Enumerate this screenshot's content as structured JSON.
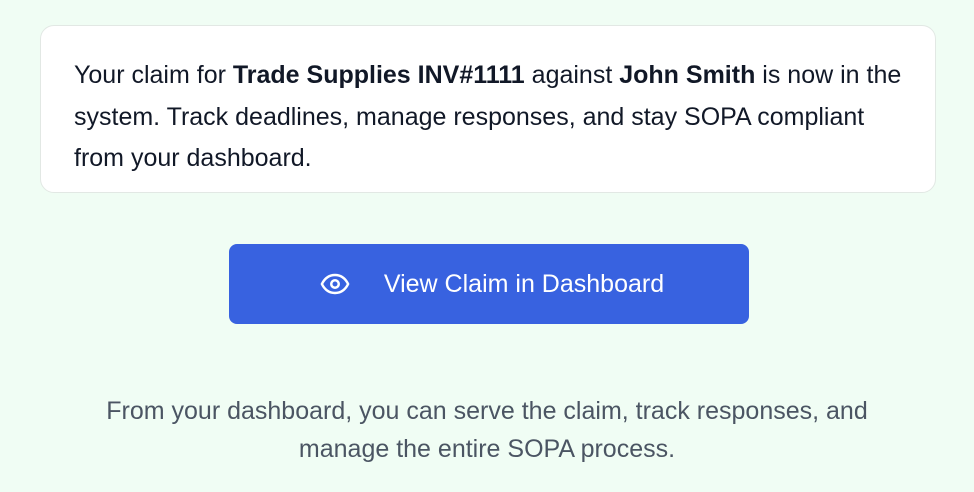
{
  "confirmation": {
    "part1": "Your claim for ",
    "claim_name": "Trade Supplies INV#1111",
    "part2": " against ",
    "respondent": "John Smith",
    "part3": " is now in the system. Track deadlines, manage responses, and stay SOPA compliant from your dashboard."
  },
  "cta": {
    "label": "View Claim in Dashboard",
    "icon": "eye-icon",
    "color": "#3862e0"
  },
  "footer": {
    "line1": "From your dashboard, you can serve the claim, track responses, and",
    "line2": "manage the entire SOPA process."
  },
  "colors": {
    "background": "#f0fdf4",
    "card": "#ffffff",
    "text": "#111827",
    "muted_text": "#4b5563"
  }
}
